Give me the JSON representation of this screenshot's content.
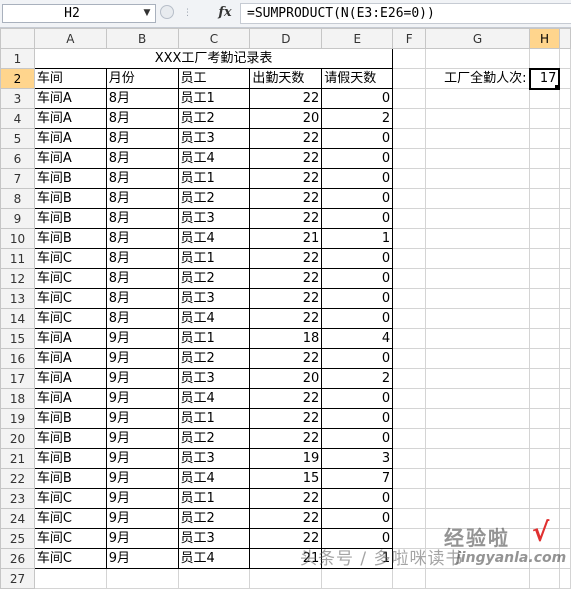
{
  "formula_bar": {
    "name_box": "H2",
    "fx_label": "fx",
    "formula": "=SUMPRODUCT(N(E3:E26=0))"
  },
  "sheet": {
    "columns": [
      "A",
      "B",
      "C",
      "D",
      "E",
      "F",
      "G",
      "H"
    ],
    "row_numbers": [
      "1",
      "2",
      "3",
      "4",
      "5",
      "6",
      "7",
      "8",
      "9",
      "10",
      "11",
      "12",
      "13",
      "14",
      "15",
      "16",
      "17",
      "18",
      "19",
      "20",
      "21",
      "22",
      "23",
      "24",
      "25",
      "26",
      "27"
    ],
    "title": "XXX工厂考勤记录表",
    "headers": [
      "车间",
      "月份",
      "员工",
      "出勤天数",
      "请假天数"
    ],
    "records": [
      [
        "车间A",
        "8月",
        "员工1",
        "22",
        "0"
      ],
      [
        "车间A",
        "8月",
        "员工2",
        "20",
        "2"
      ],
      [
        "车间A",
        "8月",
        "员工3",
        "22",
        "0"
      ],
      [
        "车间A",
        "8月",
        "员工4",
        "22",
        "0"
      ],
      [
        "车间B",
        "8月",
        "员工1",
        "22",
        "0"
      ],
      [
        "车间B",
        "8月",
        "员工2",
        "22",
        "0"
      ],
      [
        "车间B",
        "8月",
        "员工3",
        "22",
        "0"
      ],
      [
        "车间B",
        "8月",
        "员工4",
        "21",
        "1"
      ],
      [
        "车间C",
        "8月",
        "员工1",
        "22",
        "0"
      ],
      [
        "车间C",
        "8月",
        "员工2",
        "22",
        "0"
      ],
      [
        "车间C",
        "8月",
        "员工3",
        "22",
        "0"
      ],
      [
        "车间C",
        "8月",
        "员工4",
        "22",
        "0"
      ],
      [
        "车间A",
        "9月",
        "员工1",
        "18",
        "4"
      ],
      [
        "车间A",
        "9月",
        "员工2",
        "22",
        "0"
      ],
      [
        "车间A",
        "9月",
        "员工3",
        "20",
        "2"
      ],
      [
        "车间A",
        "9月",
        "员工4",
        "22",
        "0"
      ],
      [
        "车间B",
        "9月",
        "员工1",
        "22",
        "0"
      ],
      [
        "车间B",
        "9月",
        "员工2",
        "22",
        "0"
      ],
      [
        "车间B",
        "9月",
        "员工3",
        "19",
        "3"
      ],
      [
        "车间B",
        "9月",
        "员工4",
        "15",
        "7"
      ],
      [
        "车间C",
        "9月",
        "员工1",
        "22",
        "0"
      ],
      [
        "车间C",
        "9月",
        "员工2",
        "22",
        "0"
      ],
      [
        "车间C",
        "9月",
        "员工3",
        "22",
        "0"
      ],
      [
        "车间C",
        "9月",
        "员工4",
        "21",
        "1"
      ]
    ],
    "label": "工厂全勤人次:",
    "result": "17"
  },
  "watermarks": {
    "source": "头条号 / 多啦咪读书",
    "brand_cn": "经验啦",
    "brand_url": "jingyanla.com"
  },
  "colors": {
    "selected_header": "#ffd58d",
    "header_bg": "#f3f3f3",
    "check_mark": "#e03030"
  }
}
